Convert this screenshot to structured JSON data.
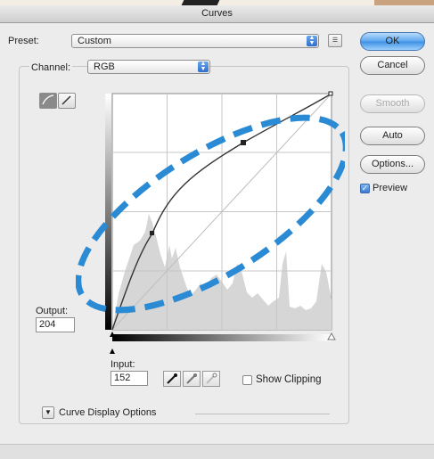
{
  "window": {
    "title": "Curves"
  },
  "preset": {
    "label": "Preset:",
    "value": "Custom"
  },
  "channel": {
    "label": "Channel:",
    "value": "RGB"
  },
  "buttons": {
    "ok": "OK",
    "cancel": "Cancel",
    "smooth": "Smooth",
    "auto": "Auto",
    "options": "Options..."
  },
  "preview": {
    "label": "Preview",
    "checked": true
  },
  "output": {
    "label": "Output:",
    "value": "204"
  },
  "input": {
    "label": "Input:",
    "value": "152"
  },
  "show_clipping": {
    "label": "Show Clipping",
    "checked": false
  },
  "curve_display_options": {
    "label": "Curve Display Options"
  },
  "colors": {
    "accent": "#3b8fe6",
    "annotation": "#2a8ad4",
    "histogram": "#d6d6d6"
  }
}
